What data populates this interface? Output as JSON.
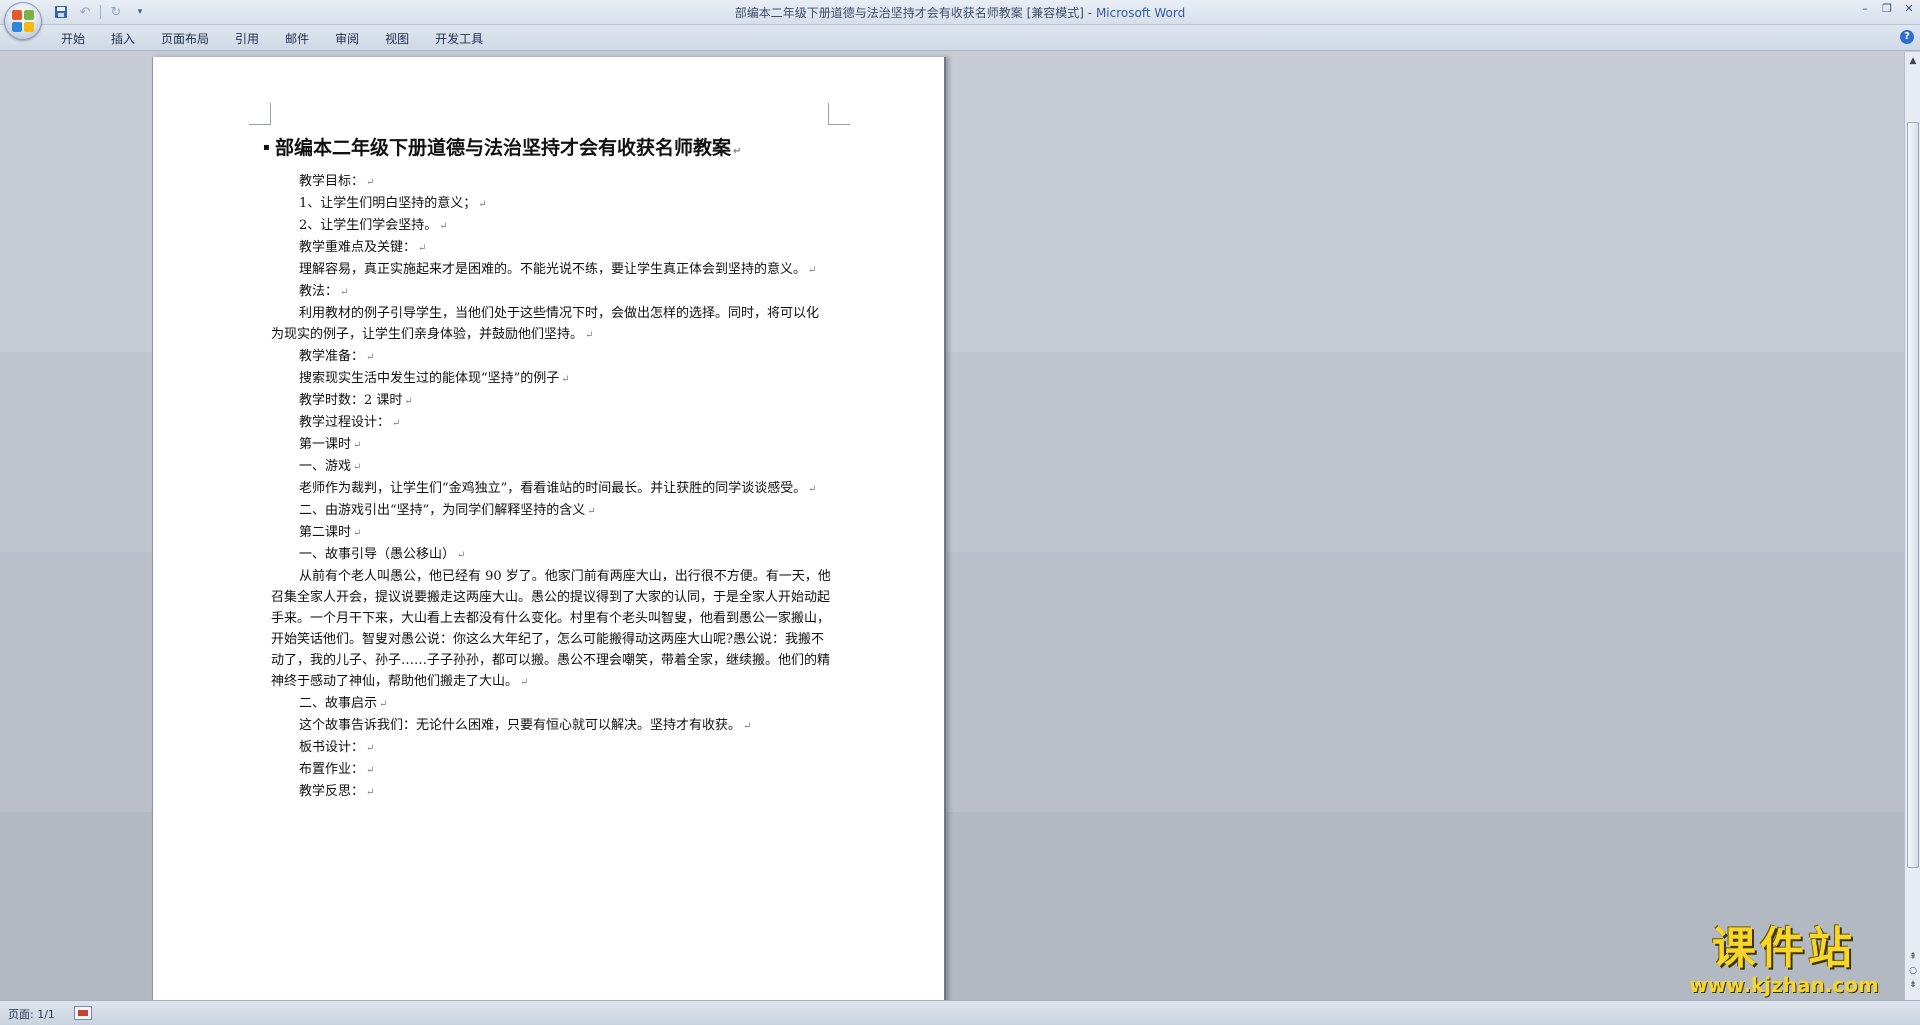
{
  "window": {
    "title_doc": "部编本二年级下册道德与法治坚持才会有收获名师教案 [兼容模式]",
    "title_sep": " - ",
    "title_app": "Microsoft Word"
  },
  "ribbon": {
    "tabs": [
      "开始",
      "插入",
      "页面布局",
      "引用",
      "邮件",
      "审阅",
      "视图",
      "开发工具"
    ]
  },
  "document": {
    "title": "部编本二年级下册道德与法治坚持才会有收获名师教案",
    "paragraphs": [
      {
        "text": "教学目标：",
        "style": "indent"
      },
      {
        "text": "1、让学生们明白坚持的意义；",
        "style": "indent"
      },
      {
        "text": "2、让学生们学会坚持。",
        "style": "indent"
      },
      {
        "text": "教学重难点及关键：",
        "style": "indent"
      },
      {
        "text": "理解容易，真正实施起来才是困难的。不能光说不练，要让学生真正体会到坚持的意义。",
        "style": "indent"
      },
      {
        "text": "教法：",
        "style": "indent"
      },
      {
        "text": "利用教材的例子引导学生，当他们处于这些情况下时，会做出怎样的选择。同时，将可以化为现实的例子，让学生们亲身体验，并鼓励他们坚持。",
        "style": "wrap"
      },
      {
        "text": "教学准备：",
        "style": "indent"
      },
      {
        "text": "搜索现实生活中发生过的能体现“坚持”的例子",
        "style": "indent"
      },
      {
        "text": "教学时数：2 课时",
        "style": "indent"
      },
      {
        "text": "教学过程设计：",
        "style": "indent"
      },
      {
        "text": "第一课时",
        "style": "indent"
      },
      {
        "text": "一、游戏",
        "style": "indent"
      },
      {
        "text": "老师作为裁判，让学生们“金鸡独立”，看看谁站的时间最长。并让获胜的同学谈谈感受。",
        "style": "wrap"
      },
      {
        "text": "二、由游戏引出“坚持”，为同学们解释坚持的含义",
        "style": "indent"
      },
      {
        "text": "第二课时",
        "style": "indent"
      },
      {
        "text": "一、故事引导（愚公移山）",
        "style": "indent"
      },
      {
        "text": "从前有个老人叫愚公，他已经有 90 岁了。他家门前有两座大山，出行很不方便。有一天，他召集全家人开会，提议说要搬走这两座大山。愚公的提议得到了大家的认同，于是全家人开始动起手来。一个月干下来，大山看上去都没有什么变化。村里有个老头叫智叟，他看到愚公一家搬山，开始笑话他们。智叟对愚公说：你这么大年纪了，怎么可能搬得动这两座大山呢?愚公说：我搬不动了，我的儿子、孙子……子子孙孙，都可以搬。愚公不理会嘲笑，带着全家，继续搬。他们的精神终于感动了神仙，帮助他们搬走了大山。",
        "style": "wrap"
      },
      {
        "text": "二、故事启示",
        "style": "indent"
      },
      {
        "text": "这个故事告诉我们：无论什么困难，只要有恒心就可以解决。坚持才有收获。",
        "style": "indent"
      },
      {
        "text": "板书设计：",
        "style": "indent"
      },
      {
        "text": "布置作业：",
        "style": "indent"
      },
      {
        "text": "教学反思：",
        "style": "indent"
      }
    ],
    "paragraph_mark": "↵"
  },
  "status": {
    "page": "页面: 1/1"
  },
  "watermark": {
    "big": "课件站",
    "small": "www.kjzhan.com"
  },
  "icons": {
    "save": "save-icon",
    "undo": "undo-icon",
    "redo": "redo-icon",
    "help": "help-icon"
  }
}
